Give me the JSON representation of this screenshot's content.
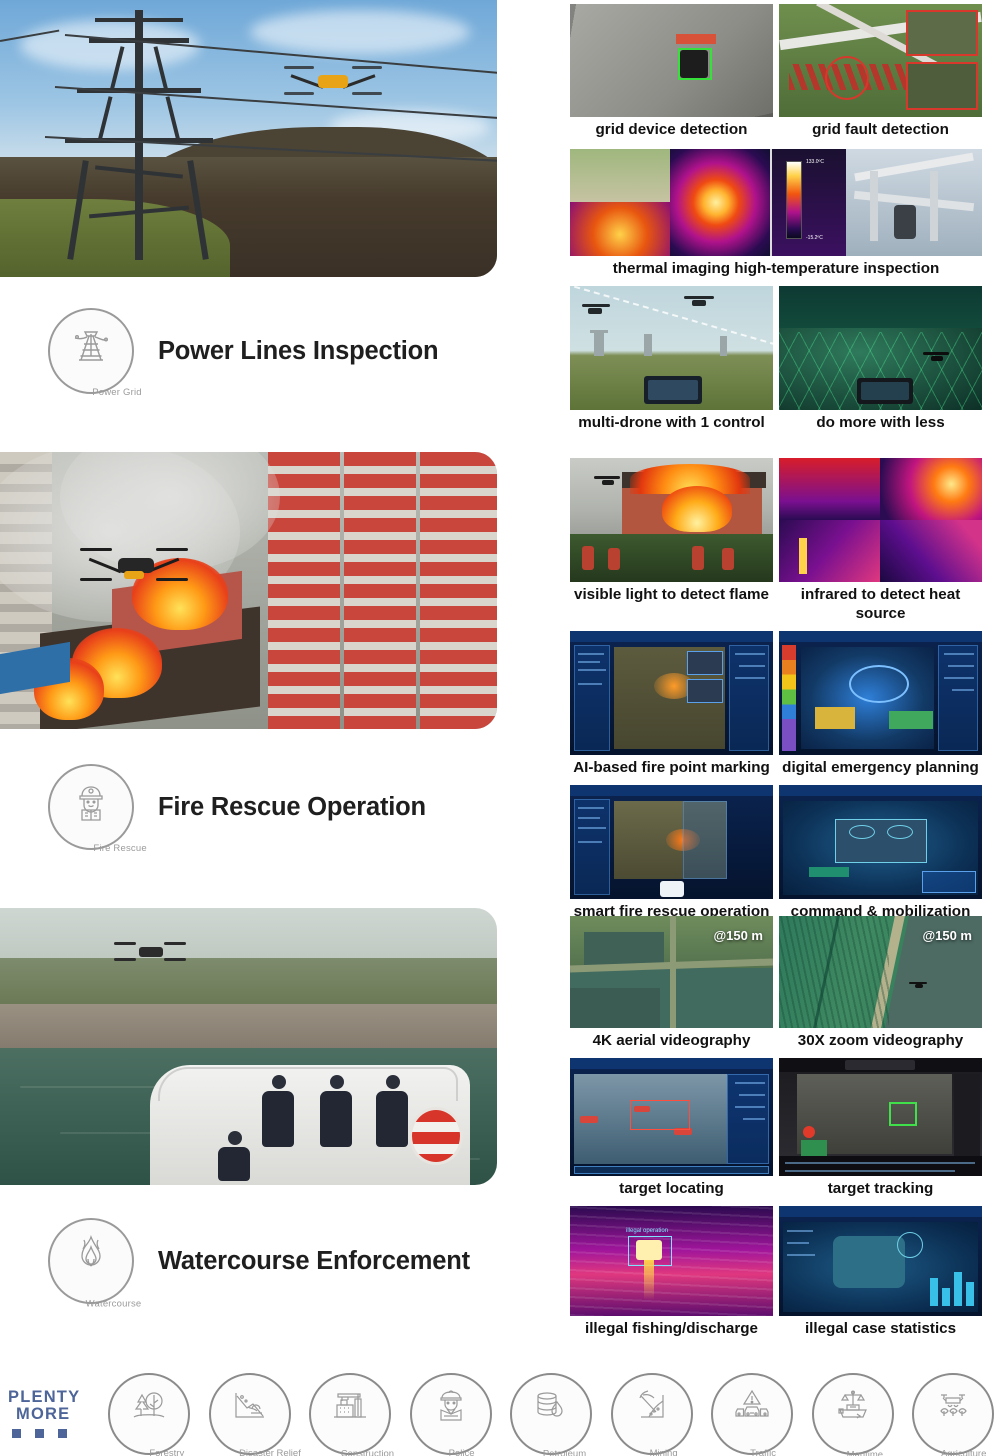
{
  "sections": [
    {
      "id": "power",
      "badge_caption": "Power Grid",
      "badge_icon": "power-tower-icon",
      "heading": "Power Lines Inspection",
      "thumbs": [
        {
          "label": "grid device detection",
          "icon": "grid-device-photo"
        },
        {
          "label": "grid fault detection",
          "icon": "grid-fault-photo"
        },
        {
          "label": "thermal imaging high-temperature inspection",
          "icon": "thermal-imaging-photo",
          "wide": true
        },
        {
          "label": "multi-drone with 1 control",
          "icon": "multi-drone-photo"
        },
        {
          "label": "do more with less",
          "icon": "do-more-with-less-photo"
        }
      ]
    },
    {
      "id": "fire",
      "badge_caption": "Fire Rescue",
      "badge_icon": "firefighter-icon",
      "heading": "Fire Rescue Operation",
      "thumbs": [
        {
          "label": "visible light to detect flame",
          "icon": "visible-flame-photo"
        },
        {
          "label": "infrared to detect heat source",
          "icon": "infrared-heat-photo"
        },
        {
          "label": "AI-based fire point marking",
          "icon": "ai-fire-point-ui"
        },
        {
          "label": "digital emergency planning",
          "icon": "digital-emergency-ui"
        },
        {
          "label": "smart fire rescue operation",
          "icon": "smart-rescue-ui"
        },
        {
          "label": "command & mobilization",
          "icon": "command-mobilization-ui"
        }
      ]
    },
    {
      "id": "water",
      "badge_caption": "Watercourse",
      "badge_icon": "water-flame-icon",
      "heading": "Watercourse Enforcement",
      "thumbs": [
        {
          "label": "4K aerial videography",
          "icon": "aerial-4k-photo",
          "overlay": "@150 m"
        },
        {
          "label": "30X zoom videography",
          "icon": "zoom-30x-photo",
          "overlay": "@150 m"
        },
        {
          "label": "target locating",
          "icon": "target-locating-ui"
        },
        {
          "label": "target tracking",
          "icon": "target-tracking-ui"
        },
        {
          "label": "illegal fishing/discharge",
          "icon": "illegal-fishing-thermal"
        },
        {
          "label": "illegal case statistics",
          "icon": "illegal-case-statistics-ui"
        }
      ]
    }
  ],
  "bottom": {
    "logo_line1": "PLENTY",
    "logo_line2": "MORE",
    "accent_color": "#4d6598",
    "chips": [
      {
        "label": "Forestry",
        "icon": "tree-icon"
      },
      {
        "label": "Disaster Relief",
        "icon": "landslide-icon"
      },
      {
        "label": "Construction",
        "icon": "crane-building-icon"
      },
      {
        "label": "Police",
        "icon": "police-officer-icon"
      },
      {
        "label": "Petroleum",
        "icon": "oil-barrel-drop-icon"
      },
      {
        "label": "Mining",
        "icon": "pickaxe-icon"
      },
      {
        "label": "Traffic",
        "icon": "cars-warning-icon"
      },
      {
        "label": "Maritime",
        "icon": "ship-scales-icon"
      },
      {
        "label": "Agriculture",
        "icon": "agri-drone-icon"
      }
    ]
  }
}
